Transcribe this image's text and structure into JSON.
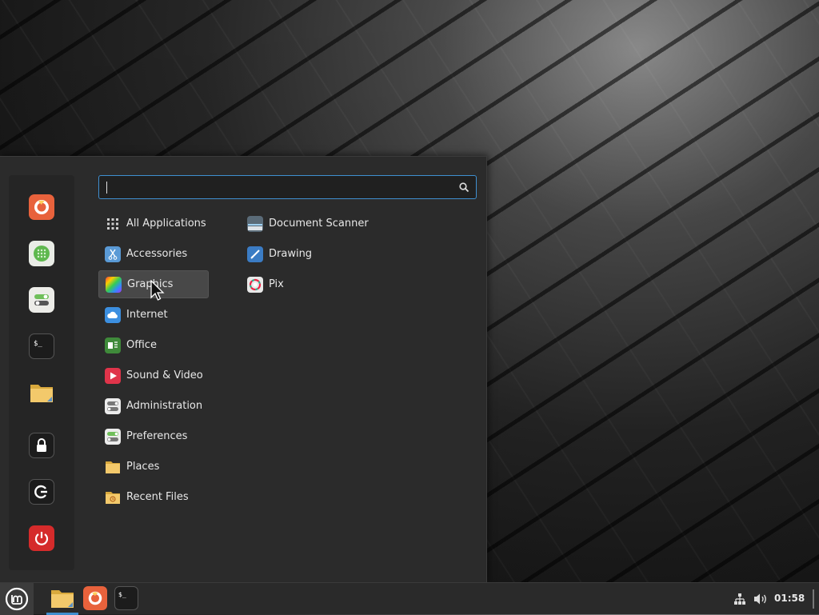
{
  "desktop": {
    "background": "dark-geometric-tiles"
  },
  "menu": {
    "search": {
      "value": "",
      "placeholder": "",
      "icon": "search-icon"
    },
    "favorites": [
      {
        "name": "firefox",
        "icon": "firefox-icon"
      },
      {
        "name": "software-manager",
        "icon": "software-manager-icon"
      },
      {
        "name": "system-settings",
        "icon": "settings-toggle-icon"
      },
      {
        "name": "terminal",
        "icon": "terminal-icon"
      },
      {
        "name": "files",
        "icon": "folder-icon"
      },
      {
        "name": "lock-screen",
        "icon": "lock-icon"
      },
      {
        "name": "logout",
        "icon": "logout-icon"
      },
      {
        "name": "shutdown",
        "icon": "power-icon"
      }
    ],
    "categories": [
      {
        "label": "All Applications",
        "icon": "grid-icon"
      },
      {
        "label": "Accessories",
        "icon": "scissors-icon"
      },
      {
        "label": "Graphics",
        "icon": "rainbow-icon",
        "selected": true
      },
      {
        "label": "Internet",
        "icon": "cloud-icon"
      },
      {
        "label": "Office",
        "icon": "office-icon"
      },
      {
        "label": "Sound & Video",
        "icon": "play-icon"
      },
      {
        "label": "Administration",
        "icon": "admin-toggle-icon"
      },
      {
        "label": "Preferences",
        "icon": "preferences-toggle-icon"
      },
      {
        "label": "Places",
        "icon": "folder-icon"
      },
      {
        "label": "Recent Files",
        "icon": "recent-folder-icon"
      }
    ],
    "applications": [
      {
        "label": "Document Scanner",
        "icon": "scanner-icon"
      },
      {
        "label": "Drawing",
        "icon": "drawing-icon"
      },
      {
        "label": "Pix",
        "icon": "pix-icon"
      }
    ]
  },
  "taskbar": {
    "menu_icon": "linux-mint-logo-icon",
    "apps": [
      {
        "name": "files",
        "icon": "folder-icon",
        "active": true
      },
      {
        "name": "firefox",
        "icon": "firefox-icon"
      },
      {
        "name": "terminal",
        "icon": "terminal-icon"
      }
    ],
    "tray": {
      "network_icon": "network-icon",
      "volume_icon": "volume-icon",
      "clock": "01:58"
    }
  },
  "colors": {
    "accent": "#3f8fd0",
    "menu_bg": "#2b2b2b",
    "power_red": "#d52b2b",
    "firefox_orange": "#e8623c"
  }
}
